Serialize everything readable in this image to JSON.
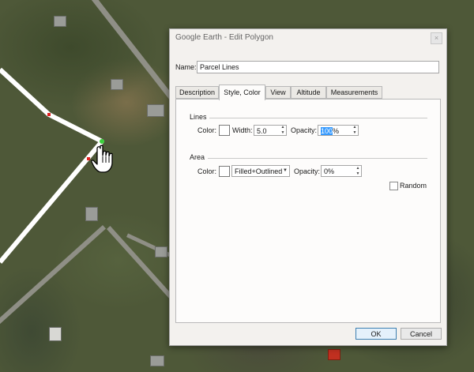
{
  "window": {
    "title": "Google Earth - Edit Polygon",
    "close_glyph": "×"
  },
  "name_field": {
    "label": "Name:",
    "value": "Parcel Lines"
  },
  "tabs": [
    {
      "label": "Description",
      "active": false
    },
    {
      "label": "Style, Color",
      "active": true
    },
    {
      "label": "View",
      "active": false
    },
    {
      "label": "Altitude",
      "active": false
    },
    {
      "label": "Measurements",
      "active": false
    }
  ],
  "lines": {
    "header": "Lines",
    "color_label": "Color:",
    "color_value": "#ffffff",
    "width_label": "Width:",
    "width_value": "5.0",
    "opacity_label": "Opacity:",
    "opacity_number": "100",
    "opacity_unit": "%"
  },
  "area": {
    "header": "Area",
    "color_label": "Color:",
    "color_value": "#ffffff",
    "fill_mode": "Filled+Outlined",
    "opacity_label": "Opacity:",
    "opacity_value": "0%"
  },
  "random": {
    "label": "Random",
    "checked": false
  },
  "buttons": {
    "ok": "OK",
    "cancel": "Cancel"
  },
  "icons": {
    "cursor": "hand-pointer-icon",
    "spin": "spinner-arrows-icon",
    "dropdown": "chevron-down-icon"
  },
  "colors": {
    "polygon_line": "#ffffff",
    "vertex": "#e02020",
    "active_vertex": "#3ad03a"
  }
}
